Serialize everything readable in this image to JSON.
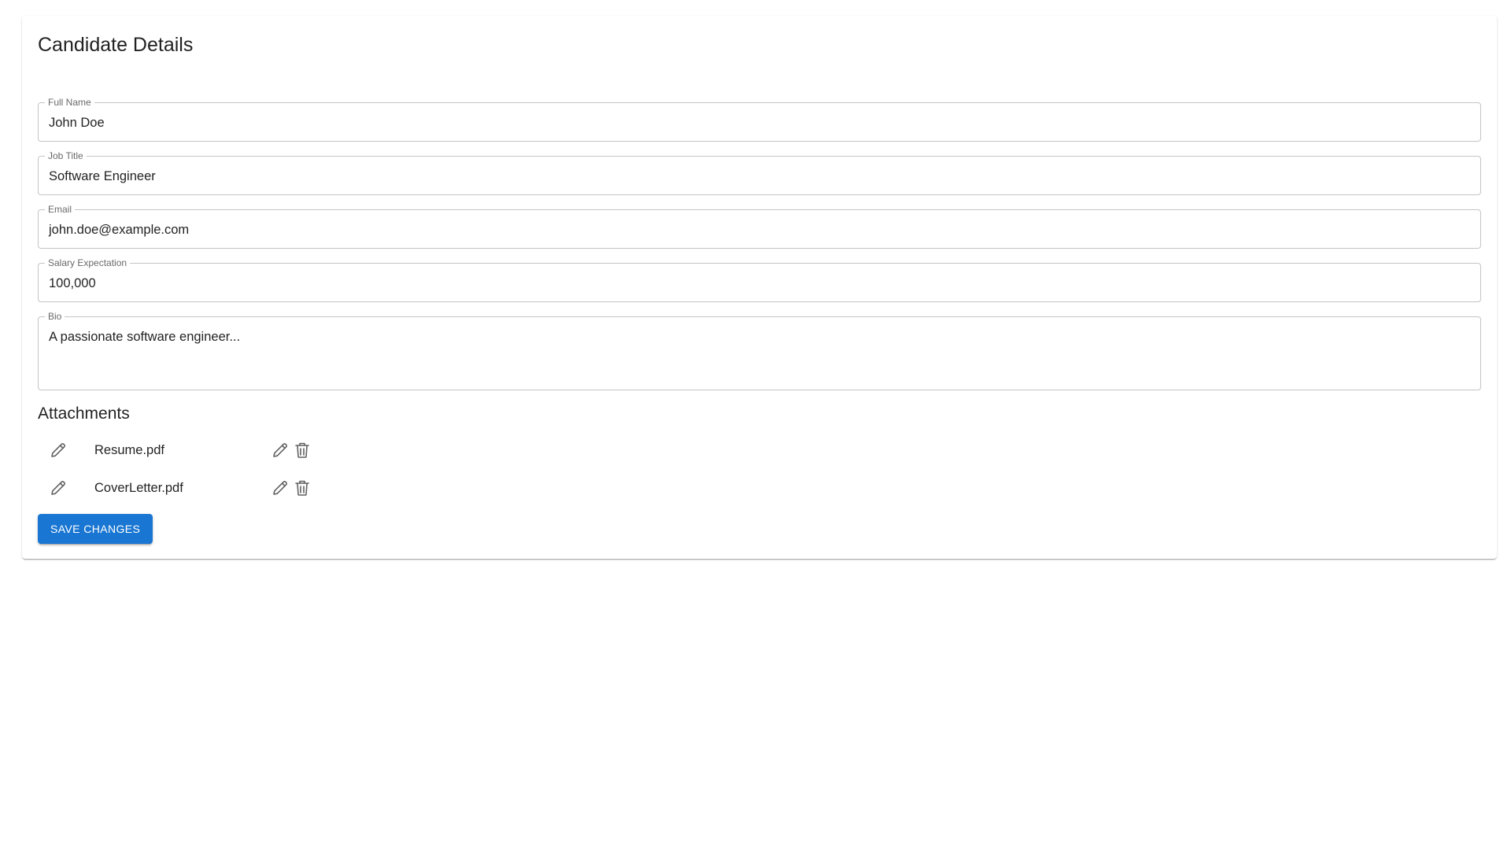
{
  "page": {
    "title": "Candidate Details"
  },
  "form": {
    "full_name": {
      "label": "Full Name",
      "value": "John Doe"
    },
    "job_title": {
      "label": "Job Title",
      "value": "Software Engineer"
    },
    "email": {
      "label": "Email",
      "value": "john.doe@example.com"
    },
    "salary": {
      "label": "Salary Expectation",
      "value": "100,000"
    },
    "bio": {
      "label": "Bio",
      "value": "A passionate software engineer..."
    }
  },
  "attachments": {
    "title": "Attachments",
    "items": [
      {
        "name": "Resume.pdf",
        "lead_icon": "pencil-icon",
        "actions": [
          "pencil-icon",
          "trash-icon"
        ]
      },
      {
        "name": "CoverLetter.pdf",
        "lead_icon": "pencil-icon",
        "actions": [
          "pencil-icon",
          "trash-icon"
        ]
      }
    ]
  },
  "actions": {
    "save_label": "Save Changes"
  },
  "colors": {
    "primary": "#1976d2",
    "icon": "#616161",
    "border": "#c4c4c4",
    "text": "#212121"
  }
}
